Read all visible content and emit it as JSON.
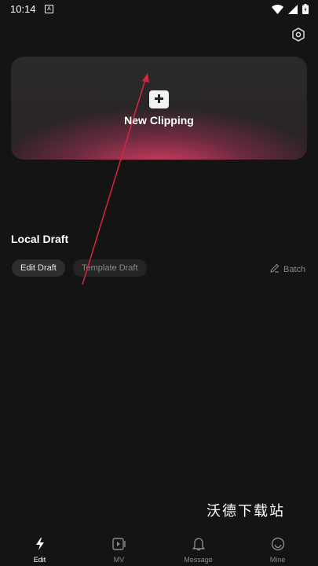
{
  "status_bar": {
    "time": "10:14",
    "notification_icon": "notification-icon",
    "icons": [
      "wifi-icon",
      "signal-icon",
      "battery-icon"
    ]
  },
  "header": {
    "settings_icon": "settings-icon"
  },
  "new_clip": {
    "label": "New Clipping",
    "icon": "plus-icon",
    "accent_color": "#e74068"
  },
  "drafts": {
    "title": "Local Draft",
    "tabs": [
      {
        "label": "Edit Draft",
        "active": true
      },
      {
        "label": "Template Draft",
        "active": false
      }
    ],
    "batch_label": "Batch"
  },
  "watermark": "沃德下载站",
  "bottom_nav": {
    "items": [
      {
        "label": "Edit",
        "icon": "lightning-icon",
        "active": true
      },
      {
        "label": "MV",
        "icon": "video-icon",
        "active": false
      },
      {
        "label": "Message",
        "icon": "bell-icon",
        "active": false
      },
      {
        "label": "Mine",
        "icon": "smiley-icon",
        "active": false
      }
    ]
  }
}
